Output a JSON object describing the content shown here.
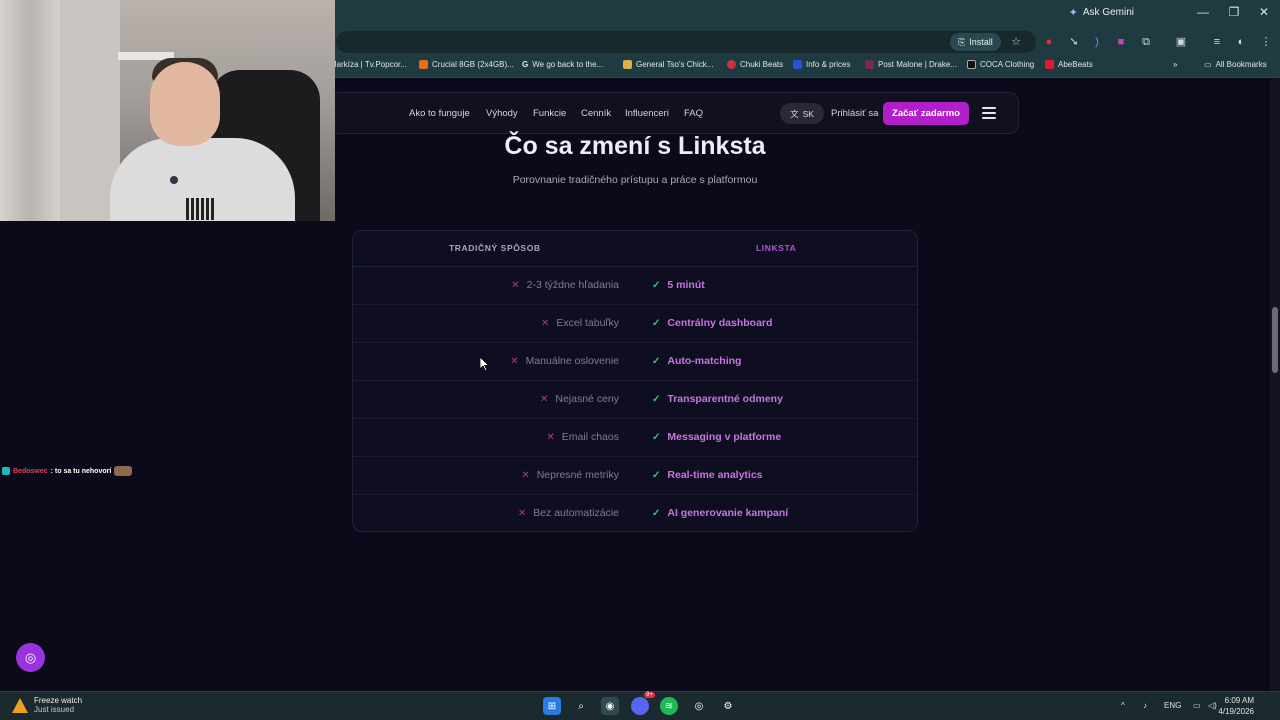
{
  "browser": {
    "ask_gemini": "Ask Gemini",
    "install_label": "Install",
    "bookmarks": [
      {
        "label": "Markíza | Tv.Popcor...",
        "color": "#2b6cd6"
      },
      {
        "label": "Crucial 8GB (2x4GB)...",
        "color": "#e86a1a"
      },
      {
        "label": "We go back to the...",
        "color": "#4285f4"
      },
      {
        "label": "General Tso's Chick...",
        "color": "#d8b24a"
      },
      {
        "label": "Chuki Beats",
        "color": "#d03040"
      },
      {
        "label": "Info & prices",
        "color": "#2454d8"
      },
      {
        "label": "Post Malone | Drake...",
        "color": "#7a2a4a"
      },
      {
        "label": "COCA Clothing",
        "color": "#222222"
      },
      {
        "label": "AbeBeats",
        "color": "#d82030"
      }
    ],
    "all_bookmarks": "All Bookmarks"
  },
  "nav": {
    "links": [
      "Ako to funguje",
      "Výhody",
      "Funkcie",
      "Cenník",
      "Influenceri",
      "FAQ"
    ],
    "lang": "SK",
    "login": "Prihlásiť sa",
    "cta": "Začať zadarmo"
  },
  "section": {
    "title": "Čo sa zmení s Linksta",
    "subtitle": "Porovnanie tradičného prístupu a práce s platformou"
  },
  "comparison": {
    "col_old": "TRADIČNÝ SPÔSOB",
    "col_new": "LINKSTA",
    "rows": [
      {
        "old": "2-3 týždne hľadania",
        "new": "5 minút"
      },
      {
        "old": "Excel tabuľky",
        "new": "Centrálny dashboard"
      },
      {
        "old": "Manuálne oslovenie",
        "new": "Auto-matching"
      },
      {
        "old": "Nejasné ceny",
        "new": "Transparentné odmeny"
      },
      {
        "old": "Email chaos",
        "new": "Messaging v platforme"
      },
      {
        "old": "Nepresné metriky",
        "new": "Real-time analytics"
      },
      {
        "old": "Bez automatizácie",
        "new": "AI generovanie kampaní"
      }
    ]
  },
  "chat": {
    "user": "Bedoswec",
    "message": ": to sa tu nehovorí"
  },
  "taskbar": {
    "notif_title": "Freeze watch",
    "notif_sub": "Just issued",
    "lang": "ENG",
    "time": "6:09 AM",
    "date": "4/19/2026",
    "discord_badge": "9+"
  }
}
